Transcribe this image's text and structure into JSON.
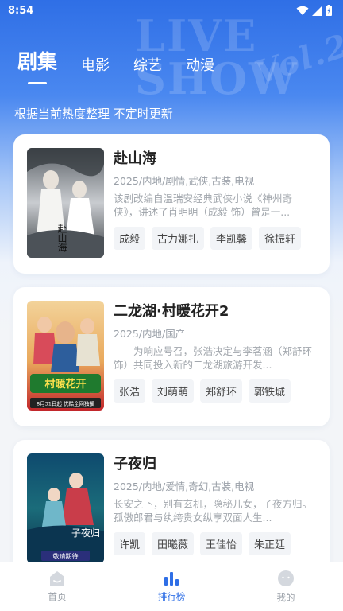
{
  "status": {
    "time": "8:54"
  },
  "background": {
    "watermark_text": "LIVE",
    "watermark_text2": "SHOW",
    "watermark_vol": "Vol.2"
  },
  "tabs": [
    {
      "label": "剧集",
      "active": true
    },
    {
      "label": "电影",
      "active": false
    },
    {
      "label": "综艺",
      "active": false
    },
    {
      "label": "动漫",
      "active": false
    }
  ],
  "subtitle": "根据当前热度整理 不定时更新",
  "items": [
    {
      "title": "赴山海",
      "meta": "2025/内地/剧情,武侠,古装,电视",
      "desc": "该剧改编自温瑞安经典武侠小说《神州奇侠》，讲述了肖明明（成毅 饰）曾是一...",
      "cast": [
        "成毅",
        "古力娜扎",
        "李凯馨",
        "徐振轩"
      ],
      "poster_text": "赴山海"
    },
    {
      "title": "二龙湖·村暖花开2",
      "meta": "2025/内地/国产",
      "desc": "　　为响应号召，张浩决定与李茗涵（郑舒环饰）共同投入新的二龙湖旅游开发...",
      "cast": [
        "张浩",
        "刘萌萌",
        "郑舒环",
        "郭铁城"
      ],
      "poster_text": "村暖花开",
      "poster_caption": "8月31日起 优酷全网独播"
    },
    {
      "title": "子夜归",
      "meta": "2025/内地/爱情,奇幻,古装,电视",
      "desc": "长安之下，别有玄机，隐秘儿女，子夜方归。孤傲郎君与纨绔贵女纵享双面人生...",
      "cast": [
        "许凯",
        "田曦薇",
        "王佳怡",
        "朱正廷"
      ],
      "poster_text": "子夜归",
      "poster_caption": "敬请期待"
    }
  ],
  "bottom_nav": [
    {
      "label": "首页",
      "icon": "home-icon",
      "active": false
    },
    {
      "label": "排行榜",
      "icon": "chart-icon",
      "active": true
    },
    {
      "label": "我的",
      "icon": "profile-icon",
      "active": false
    }
  ],
  "colors": {
    "accent": "#2f6fe6",
    "muted": "#9aa0a8",
    "chip_bg": "#f2f4f7"
  }
}
